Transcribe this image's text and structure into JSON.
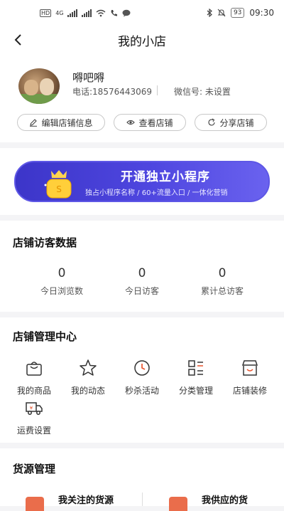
{
  "status_bar": {
    "left_badge": "HD",
    "network": "4G",
    "time": "09:30",
    "battery": "93"
  },
  "nav": {
    "title": "我的小店"
  },
  "profile": {
    "name": "嘚吧嘚",
    "phone": "电话:18576443069",
    "wechat": "微信号: 未设置",
    "buttons": {
      "edit": "编辑店铺信息",
      "view": "查看店铺",
      "share": "分享店铺"
    }
  },
  "banner": {
    "title": "开通独立小程序",
    "subtitle": "独占小程序名称 / 60+流量入口 / 一体化营销"
  },
  "visitors": {
    "title": "店铺访客数据",
    "stats": [
      {
        "value": "0",
        "label": "今日浏览数"
      },
      {
        "value": "0",
        "label": "今日访客"
      },
      {
        "value": "0",
        "label": "累计总访客"
      }
    ]
  },
  "management": {
    "title": "店铺管理中心",
    "tools": [
      {
        "label": "我的商品",
        "icon": "shopping-bag-icon"
      },
      {
        "label": "我的动态",
        "icon": "star-icon"
      },
      {
        "label": "秒杀活动",
        "icon": "clock-icon"
      },
      {
        "label": "分类管理",
        "icon": "category-icon"
      },
      {
        "label": "店铺装修",
        "icon": "storefront-icon"
      },
      {
        "label": "运费设置",
        "icon": "truck-icon"
      }
    ]
  },
  "supply": {
    "title": "货源管理",
    "items": [
      {
        "label": "我关注的货源"
      },
      {
        "label": "我供应的货"
      }
    ]
  },
  "colors": {
    "accent": "#4f47e0",
    "supply_icon": "#ea6d4b",
    "icon_stroke": "#333333"
  }
}
